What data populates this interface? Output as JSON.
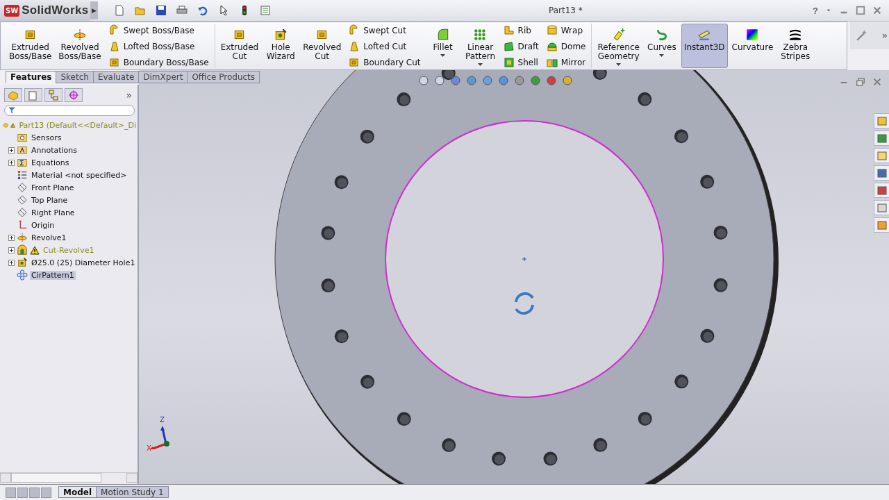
{
  "app": {
    "logo_badge": "SW",
    "logo": "SolidWorks",
    "arrow": "▶"
  },
  "window": {
    "title": "Part13 *",
    "help": "?"
  },
  "ribbon": [
    {
      "items": [
        {
          "kind": "large",
          "label": "Extruded\nBoss/Base",
          "selected": false,
          "dropdown": false
        },
        {
          "kind": "large",
          "label": "Revolved\nBoss/Base",
          "selected": false,
          "dropdown": false
        },
        {
          "kind": "stack",
          "entries": [
            {
              "label": "Swept Boss/Base"
            },
            {
              "label": "Lofted Boss/Base"
            },
            {
              "label": "Boundary Boss/Base"
            }
          ]
        }
      ]
    },
    {
      "items": [
        {
          "kind": "large",
          "label": "Extruded\nCut",
          "selected": false,
          "dropdown": false
        },
        {
          "kind": "large",
          "label": "Hole\nWizard",
          "selected": false,
          "dropdown": false
        },
        {
          "kind": "large",
          "label": "Revolved\nCut",
          "selected": false,
          "dropdown": false
        },
        {
          "kind": "stack",
          "entries": [
            {
              "label": "Swept Cut"
            },
            {
              "label": "Lofted Cut"
            },
            {
              "label": "Boundary Cut"
            }
          ]
        },
        {
          "kind": "large",
          "label": "Fillet",
          "selected": false,
          "dropdown": true
        },
        {
          "kind": "large",
          "label": "Linear\nPattern",
          "selected": false,
          "dropdown": true
        },
        {
          "kind": "stack",
          "entries": [
            {
              "label": "Rib"
            },
            {
              "label": "Draft"
            },
            {
              "label": "Shell"
            }
          ]
        },
        {
          "kind": "stack",
          "entries": [
            {
              "label": "Wrap"
            },
            {
              "label": "Dome"
            },
            {
              "label": "Mirror"
            }
          ]
        }
      ]
    },
    {
      "items": [
        {
          "kind": "large",
          "label": "Reference\nGeometry",
          "selected": false,
          "dropdown": true
        },
        {
          "kind": "large",
          "label": "Curves",
          "selected": false,
          "dropdown": true
        },
        {
          "kind": "large",
          "label": "Instant3D",
          "selected": true,
          "dropdown": false
        },
        {
          "kind": "large",
          "label": "Curvature",
          "selected": false,
          "dropdown": false
        },
        {
          "kind": "large",
          "label": "Zebra\nStripes",
          "selected": false,
          "dropdown": false
        }
      ]
    }
  ],
  "ribbon_more": "»",
  "tabs": [
    {
      "label": "Features",
      "selected": true
    },
    {
      "label": "Sketch",
      "selected": false
    },
    {
      "label": "Evaluate",
      "selected": false
    },
    {
      "label": "DimXpert",
      "selected": false
    },
    {
      "label": "Office Products",
      "selected": false
    }
  ],
  "panel": {
    "more": "»",
    "tree": [
      {
        "label": "Part13  (Default<<Default>_Di",
        "expandable": false,
        "warning": true,
        "selected": false,
        "children": [
          {
            "label": "Sensors",
            "expandable": false,
            "warning": false,
            "selected": false
          },
          {
            "label": "Annotations",
            "expandable": true,
            "warning": false,
            "selected": false
          },
          {
            "label": "Equations",
            "expandable": true,
            "warning": false,
            "selected": false
          },
          {
            "label": "Material <not specified>",
            "expandable": false,
            "warning": false,
            "selected": false
          },
          {
            "label": "Front Plane",
            "expandable": false,
            "warning": false,
            "selected": false
          },
          {
            "label": "Top Plane",
            "expandable": false,
            "warning": false,
            "selected": false
          },
          {
            "label": "Right Plane",
            "expandable": false,
            "warning": false,
            "selected": false
          },
          {
            "label": "Origin",
            "expandable": false,
            "warning": false,
            "selected": false
          },
          {
            "label": "Revolve1",
            "expandable": true,
            "warning": false,
            "selected": false
          },
          {
            "label": "Cut-Revolve1",
            "expandable": true,
            "warning": true,
            "selected": false
          },
          {
            "label": "Ø25.0 (25) Diameter Hole1",
            "expandable": true,
            "warning": false,
            "selected": false
          },
          {
            "label": "CirPattern1",
            "expandable": false,
            "warning": false,
            "selected": true
          }
        ]
      }
    ]
  },
  "triad": {
    "z": "Z",
    "x": "X"
  },
  "bottom_tabs": [
    {
      "label": "Model",
      "selected": true
    },
    {
      "label": "Motion Study 1",
      "selected": false
    }
  ]
}
